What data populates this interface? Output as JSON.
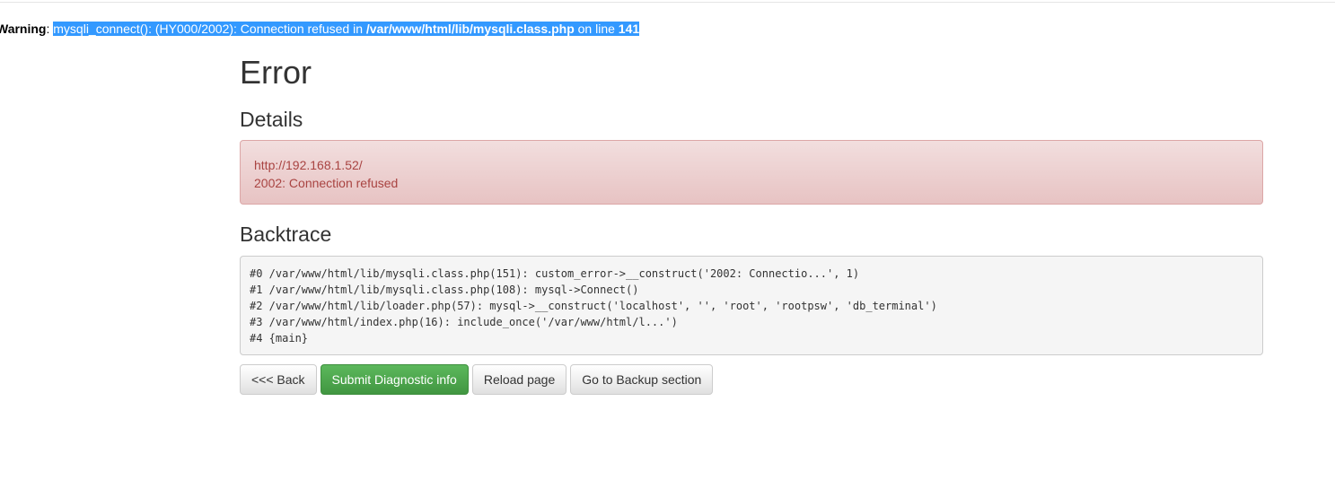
{
  "warning": {
    "label": "Warning",
    "sep": ": ",
    "message_part1": "mysqli_connect(): (HY000/2002): Connection refused in ",
    "file": "/var/www/html/lib/mysqli.class.php",
    "on_line": " on line ",
    "line_number": "141"
  },
  "page": {
    "title": "Error",
    "details_heading": "Details",
    "backtrace_heading": "Backtrace"
  },
  "details": {
    "url": "http://192.168.1.52/",
    "message": "2002: Connection refused"
  },
  "backtrace": [
    "#0 /var/www/html/lib/mysqli.class.php(151): custom_error->__construct('2002: Connectio...', 1)",
    "#1 /var/www/html/lib/mysqli.class.php(108): mysql->Connect()",
    "#2 /var/www/html/lib/loader.php(57): mysql->__construct('localhost', '', 'root', 'rootpsw', 'db_terminal')",
    "#3 /var/www/html/index.php(16): include_once('/var/www/html/l...')",
    "#4 {main}"
  ],
  "buttons": {
    "back": "<<< Back",
    "submit": "Submit Diagnostic info",
    "reload": "Reload page",
    "backup": "Go to Backup section"
  },
  "colors": {
    "selection": "#3399ff",
    "alert_text": "#a94442",
    "alert_bg": "#f2dede",
    "success": "#5cb85c"
  }
}
